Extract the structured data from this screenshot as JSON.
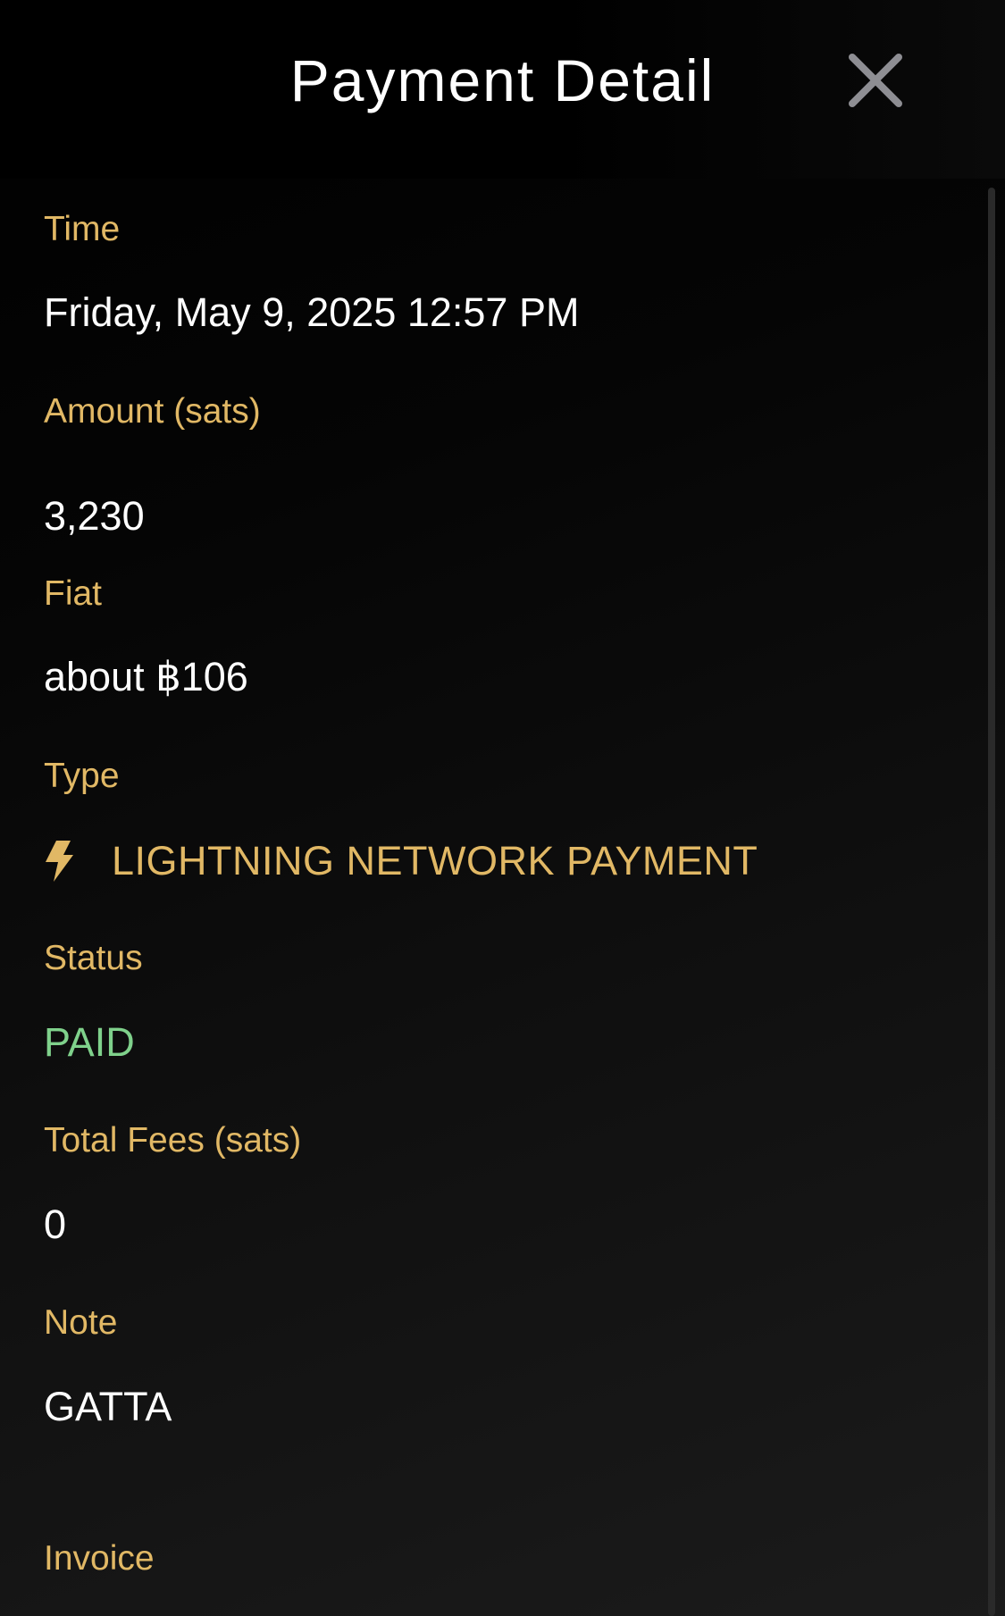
{
  "header": {
    "title": "Payment Detail",
    "close_icon": "close-icon"
  },
  "fields": {
    "time": {
      "label": "Time",
      "value": "Friday, May 9, 2025 12:57 PM"
    },
    "amount": {
      "label": "Amount (sats)",
      "value": "3,230"
    },
    "fiat": {
      "label": "Fiat",
      "value": "about ฿106"
    },
    "type": {
      "label": "Type",
      "value": "LIGHTNING NETWORK PAYMENT",
      "icon": "lightning-bolt-icon"
    },
    "status": {
      "label": "Status",
      "value": "PAID"
    },
    "fees": {
      "label": "Total Fees (sats)",
      "value": "0"
    },
    "note": {
      "label": "Note",
      "value": "GATTA"
    },
    "invoice": {
      "label": "Invoice"
    }
  },
  "colors": {
    "background": "#000000",
    "label": "#e1b865",
    "value": "#ffffff",
    "status_paid": "#7fd18b",
    "close_icon": "#8e8e93"
  }
}
